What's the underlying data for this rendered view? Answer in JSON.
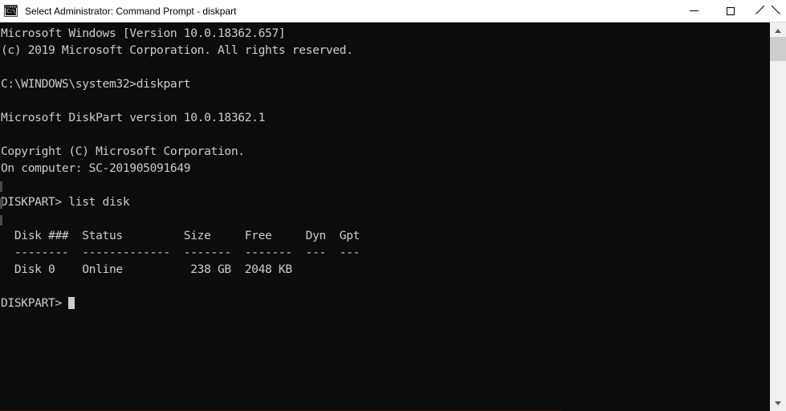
{
  "window": {
    "title": "Select Administrator: Command Prompt - diskpart",
    "icon": "command-prompt-icon",
    "icon_glyph": "C:\\_",
    "background_color": "#0c0c0c",
    "titlebar_color": "#ffffff",
    "text_color": "#cccccc"
  },
  "window_controls": {
    "minimize": {
      "name": "minimize-button",
      "glyph": "—",
      "tooltip": "Minimize"
    },
    "maximize": {
      "name": "maximize-button",
      "glyph": "□",
      "tooltip": "Maximize"
    },
    "close": {
      "name": "close-button",
      "glyph": "✕",
      "tooltip": "Close"
    }
  },
  "console": {
    "prompt_symbol": "DISKPART>",
    "cursor": "block",
    "lines": [
      "Microsoft Windows [Version 10.0.18362.657]",
      "(c) 2019 Microsoft Corporation. All rights reserved.",
      "",
      "C:\\WINDOWS\\system32>diskpart",
      "",
      "Microsoft DiskPart version 10.0.18362.1",
      "",
      "Copyright (C) Microsoft Corporation.",
      "On computer: SC-201905091649",
      "",
      "DISKPART> list disk",
      "",
      "  Disk ###  Status         Size     Free     Dyn  Gpt",
      "  --------  -------------  -------  -------  ---  ---",
      "  Disk 0    Online          238 GB  2048 KB",
      "",
      "DISKPART> "
    ],
    "os_banner": {
      "product": "Microsoft Windows",
      "version": "10.0.18362.657",
      "copyright": "(c) 2019 Microsoft Corporation. All rights reserved."
    },
    "command_entered": "diskpart",
    "working_directory": "C:\\WINDOWS\\system32",
    "diskpart": {
      "product": "Microsoft DiskPart",
      "version": "10.0.18362.1",
      "copyright": "Copyright (C) Microsoft Corporation.",
      "computer_label": "On computer:",
      "computer_name": "SC-201905091649",
      "command": "list disk"
    },
    "disk_table": {
      "headers": [
        "Disk ###",
        "Status",
        "Size",
        "Free",
        "Dyn",
        "Gpt"
      ],
      "separators": [
        "--------",
        "-------------",
        "-------",
        "-------",
        "---",
        "---"
      ],
      "rows": [
        {
          "disk": "Disk 0",
          "status": "Online",
          "size": "238 GB",
          "free": "2048 KB",
          "dyn": "",
          "gpt": ""
        }
      ]
    }
  },
  "scrollbar": {
    "name": "vertical-scrollbar",
    "up_arrow": "▲",
    "down_arrow": "▼",
    "thumb_position_percent": 0,
    "track_color": "#f0f0f0",
    "thumb_color": "#cdcdcd"
  }
}
